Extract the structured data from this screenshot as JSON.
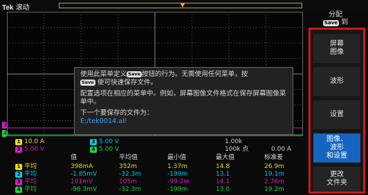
{
  "brand": {
    "name": "Tek",
    "status": "滚动"
  },
  "colors": {
    "ch1": "#e8e000",
    "ch2": "#00c8e8",
    "ch3": "#d020c0",
    "ch4": "#20d040",
    "highlight": "#1565c0",
    "frame": "#d01818",
    "grid": "#6a6a6a"
  },
  "panel": {
    "title": "分配",
    "save_key": "Save",
    "suffix": "到"
  },
  "menu": {
    "items": [
      {
        "label": "屏幕\n图像"
      },
      {
        "label": "波形"
      },
      {
        "label": "设置"
      },
      {
        "label": "图像、\n波形\n和设置"
      },
      {
        "label": "更改\n文件夹"
      }
    ]
  },
  "dialog": {
    "line1_a": "使用此菜单定义",
    "line1_b": "按钮的行为。无需使用任何菜单，按",
    "line2_b": "便可快速保存文件。",
    "key": "Save",
    "para2": "配置选项在相应的菜单中。例如，屏幕图像文件格式在保存屏幕图像菜单中。",
    "next_label": "下一个要保存的文件为：",
    "next_path": "E:/tek0014.all"
  },
  "channels": {
    "c1": {
      "num": "1",
      "scale": "10.0 A"
    },
    "c2": {
      "num": "2",
      "scale": "5.00 V"
    },
    "c3": {
      "num": "3",
      "scale": "5.00 V"
    },
    "c4": {
      "num": "4",
      "scale": "5.00 V"
    }
  },
  "timebase": {
    "window": "1.00k",
    "rate": "100k 点",
    "trigger_level": "0.00 A"
  },
  "table": {
    "headers": [
      "值",
      "平均值",
      "最小值",
      "最大值",
      "标准差"
    ],
    "rows": [
      {
        "ch": "1",
        "name": "平均",
        "values": [
          "398mA",
          "352m",
          "1.37m",
          "14.8",
          "26.9m"
        ]
      },
      {
        "ch": "2",
        "name": "平均",
        "values": [
          "-1.85mV",
          "-32.3m",
          "-199m",
          "13.1",
          "19.1m"
        ]
      },
      {
        "ch": "3",
        "name": "平均",
        "values": [
          "101mV",
          "105m",
          "-99.2m",
          "14.1",
          "2.76m"
        ]
      },
      {
        "ch": "4",
        "name": "平均",
        "values": [
          "-96.3mV",
          "-32.3m",
          "-199m",
          "13.0",
          "19.2m"
        ]
      }
    ]
  }
}
